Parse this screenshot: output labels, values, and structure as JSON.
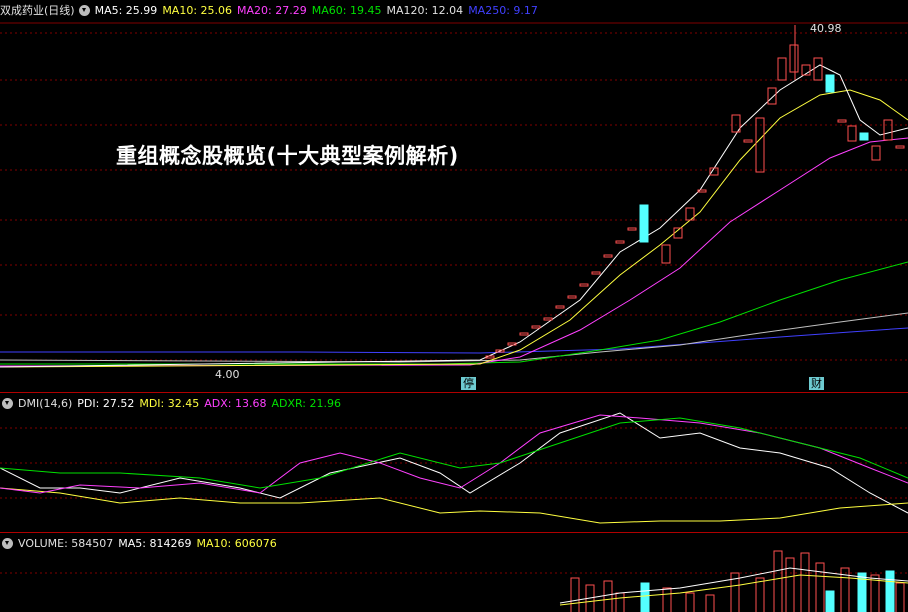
{
  "price_header": {
    "stock": "双成药业(日线)",
    "ma5": "MA5: 25.99",
    "ma10": "MA10: 25.06",
    "ma20": "MA20: 27.29",
    "ma60": "MA60: 19.45",
    "ma120": "MA120: 12.04",
    "ma250": "MA250: 9.17"
  },
  "dmi_header": {
    "name": "DMI(14,6)",
    "pdi": "PDI: 27.52",
    "mdi": "MDI: 32.45",
    "adx": "ADX: 13.68",
    "adxr": "ADXR: 21.96"
  },
  "vol_header": {
    "name": "VOLUME: 584507",
    "ma5": "MA5: 814269",
    "ma10": "MA10: 606076"
  },
  "overlay_text": "重组概念股概览(十大典型案例解析)",
  "high_label": "40.98",
  "low_label": "4.00",
  "tags": {
    "suspend": "停",
    "finance": "财"
  },
  "colors": {
    "up": "#ff5050",
    "down": "#54ffff",
    "ma5": "#ffffff",
    "ma10": "#ffff40",
    "ma20": "#ff40ff",
    "ma60": "#00e000",
    "ma120": "#c0c0c0",
    "ma250": "#4040ff",
    "grid": "#800000"
  }
}
